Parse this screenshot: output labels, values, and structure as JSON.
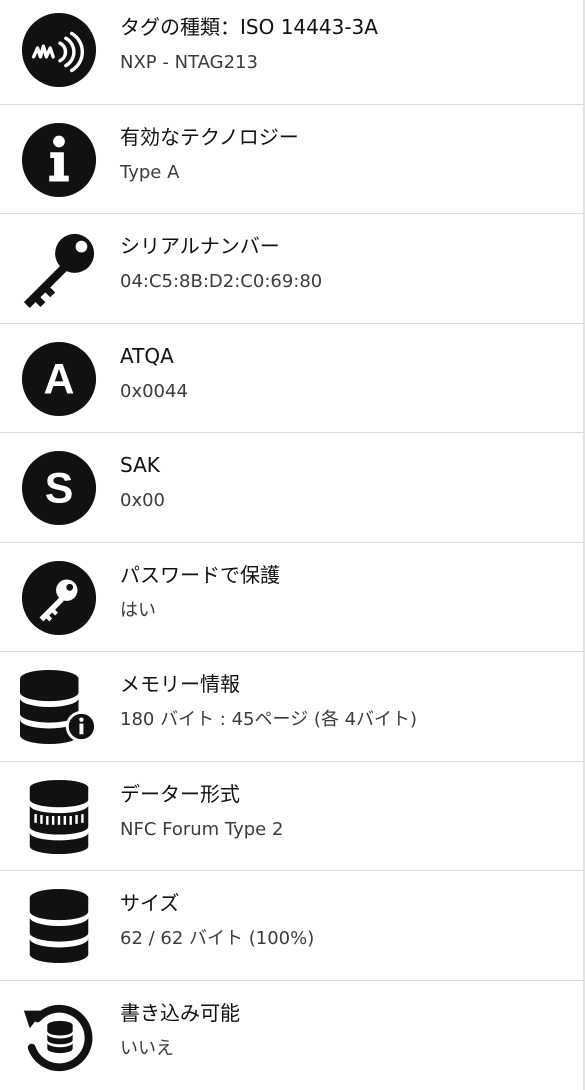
{
  "rows": [
    {
      "icon": "nfc-tag-icon",
      "title": "タグの種類：ISO 14443-3A",
      "value": "NXP - NTAG213"
    },
    {
      "icon": "info-icon",
      "title": "有効なテクノロジー",
      "value": "Type A"
    },
    {
      "icon": "key-icon",
      "title": "シリアルナンバー",
      "value": "04:C5:8B:D2:C0:69:80"
    },
    {
      "icon": "letter-a-icon",
      "title": "ATQA",
      "value": "0x0044"
    },
    {
      "icon": "letter-s-icon",
      "title": "SAK",
      "value": "0x00"
    },
    {
      "icon": "password-key-icon",
      "title": "パスワードで保護",
      "value": "はい"
    },
    {
      "icon": "memory-info-icon",
      "title": "メモリー情報",
      "value": "180 バイト : 45ページ (各 4バイト)"
    },
    {
      "icon": "data-format-icon",
      "title": "データー形式",
      "value": "NFC Forum Type 2"
    },
    {
      "icon": "size-database-icon",
      "title": "サイズ",
      "value": "62 / 62 バイト (100%)"
    },
    {
      "icon": "writable-history-icon",
      "title": "書き込み可能",
      "value": "いいえ"
    }
  ]
}
